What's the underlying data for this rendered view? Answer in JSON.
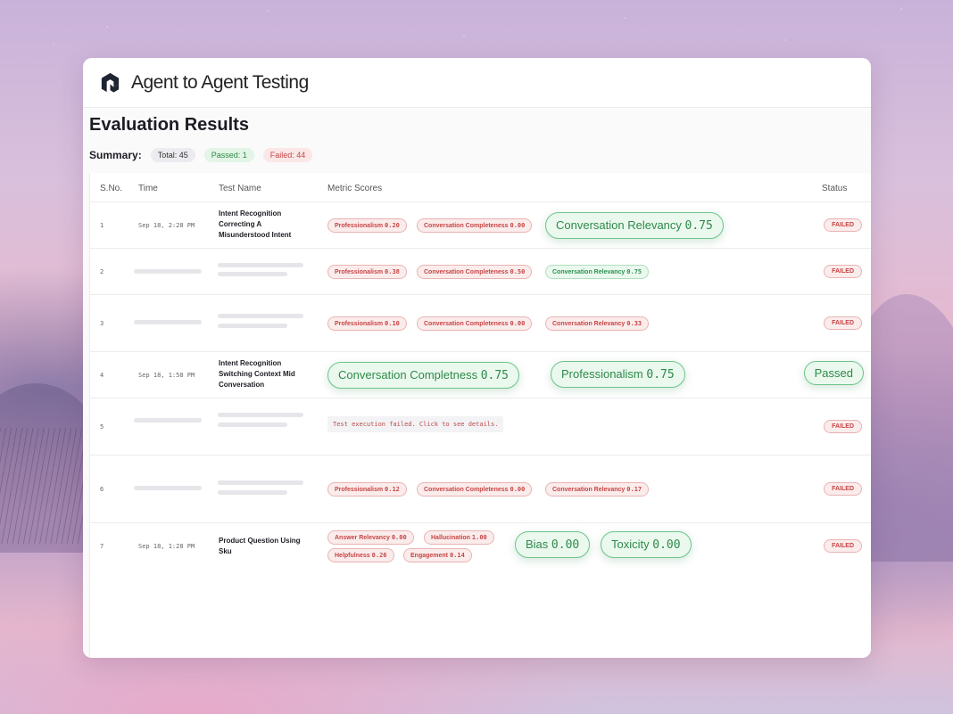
{
  "app": {
    "title": "Agent to Agent Testing"
  },
  "page": {
    "title": "Evaluation Results"
  },
  "summary": {
    "label": "Summary:",
    "total": "Total: 45",
    "passed": "Passed: 1",
    "failed": "Failed: 44"
  },
  "table": {
    "headers": {
      "sno": "S.No.",
      "time": "Time",
      "name": "Test Name",
      "metrics": "Metric Scores",
      "status": "Status"
    },
    "rows": [
      {
        "sno": "1",
        "time": "Sep 18, 2:28 PM",
        "name": "Intent Recognition Correcting A Misunderstood Intent",
        "m1": "Professionalism",
        "v1": "0.20",
        "m2": "Conversation Completeness",
        "v2": "0.00",
        "m3": "Conversation Relevancy",
        "v3": "0.75",
        "status": "FAILED"
      },
      {
        "sno": "2",
        "m1": "Professionalism",
        "v1": "0.38",
        "m2": "Conversation Completeness",
        "v2": "0.50",
        "m3": "Conversation Relevancy",
        "v3": "0.75",
        "status": "FAILED"
      },
      {
        "sno": "3",
        "m1": "Professionalism",
        "v1": "0.10",
        "m2": "Conversation Completeness",
        "v2": "0.00",
        "m3": "Conversation Relevancy",
        "v3": "0.33",
        "status": "FAILED"
      },
      {
        "sno": "4",
        "time": "Sep 18, 1:58 PM",
        "name": "Intent Recognition Switching Context Mid Conversation",
        "m1": "Conversation Completness",
        "v1": "0.75",
        "m2": "Professionalism",
        "v2": "0.75",
        "status": "Passed"
      },
      {
        "sno": "5",
        "error": "Test execution failed. Click to see details.",
        "status": "FAILED"
      },
      {
        "sno": "6",
        "m1": "Professionalism",
        "v1": "0.12",
        "m2": "Conversation Completeness",
        "v2": "0.00",
        "m3": "Conversation Relevancy",
        "v3": "0.17",
        "status": "FAILED"
      },
      {
        "sno": "7",
        "time": "Sep 18, 1:28 PM",
        "name": "Product Question Using Sku",
        "m1": "Answer Relevancy",
        "v1": "0.00",
        "m2": "Hallucination",
        "v2": "1.00",
        "m3": "Helpfulness",
        "v3": "0.26",
        "m4": "Engagement",
        "v4": "0.14",
        "m5": "Bias",
        "v5": "0.00",
        "m6": "Toxicity",
        "v6": "0.00",
        "status": "FAILED"
      }
    ]
  }
}
